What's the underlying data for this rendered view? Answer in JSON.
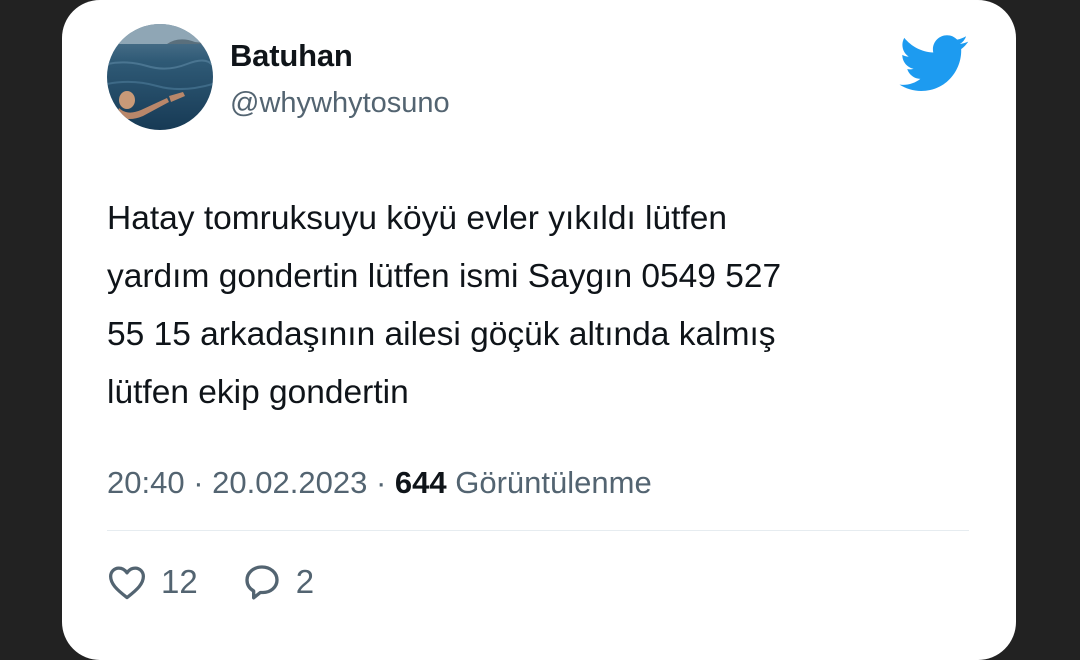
{
  "tweet": {
    "author_name": "Batuhan",
    "author_handle": "@whywhytosuno",
    "text": "Hatay tomruksuyu köyü evler yıkıldı lütfen\nyardım gondertin lütfen ismi Saygın  0549 527\n55 15 arkadaşının ailesi göçük altında kalmış\nlütfen ekip gondertin",
    "time": "20:40",
    "date": "20.02.2023",
    "separator": "·",
    "view_count": "644",
    "view_label": "Görüntülenme",
    "likes": "12",
    "replies": "2"
  },
  "icons": {
    "logo": "twitter-bird-icon",
    "like": "heart-icon",
    "reply": "comment-bubble-icon"
  },
  "colors": {
    "brand": "#1d9bf0",
    "text_primary": "#0f1419",
    "text_secondary": "#536471",
    "background": "#222222",
    "card": "#ffffff"
  }
}
